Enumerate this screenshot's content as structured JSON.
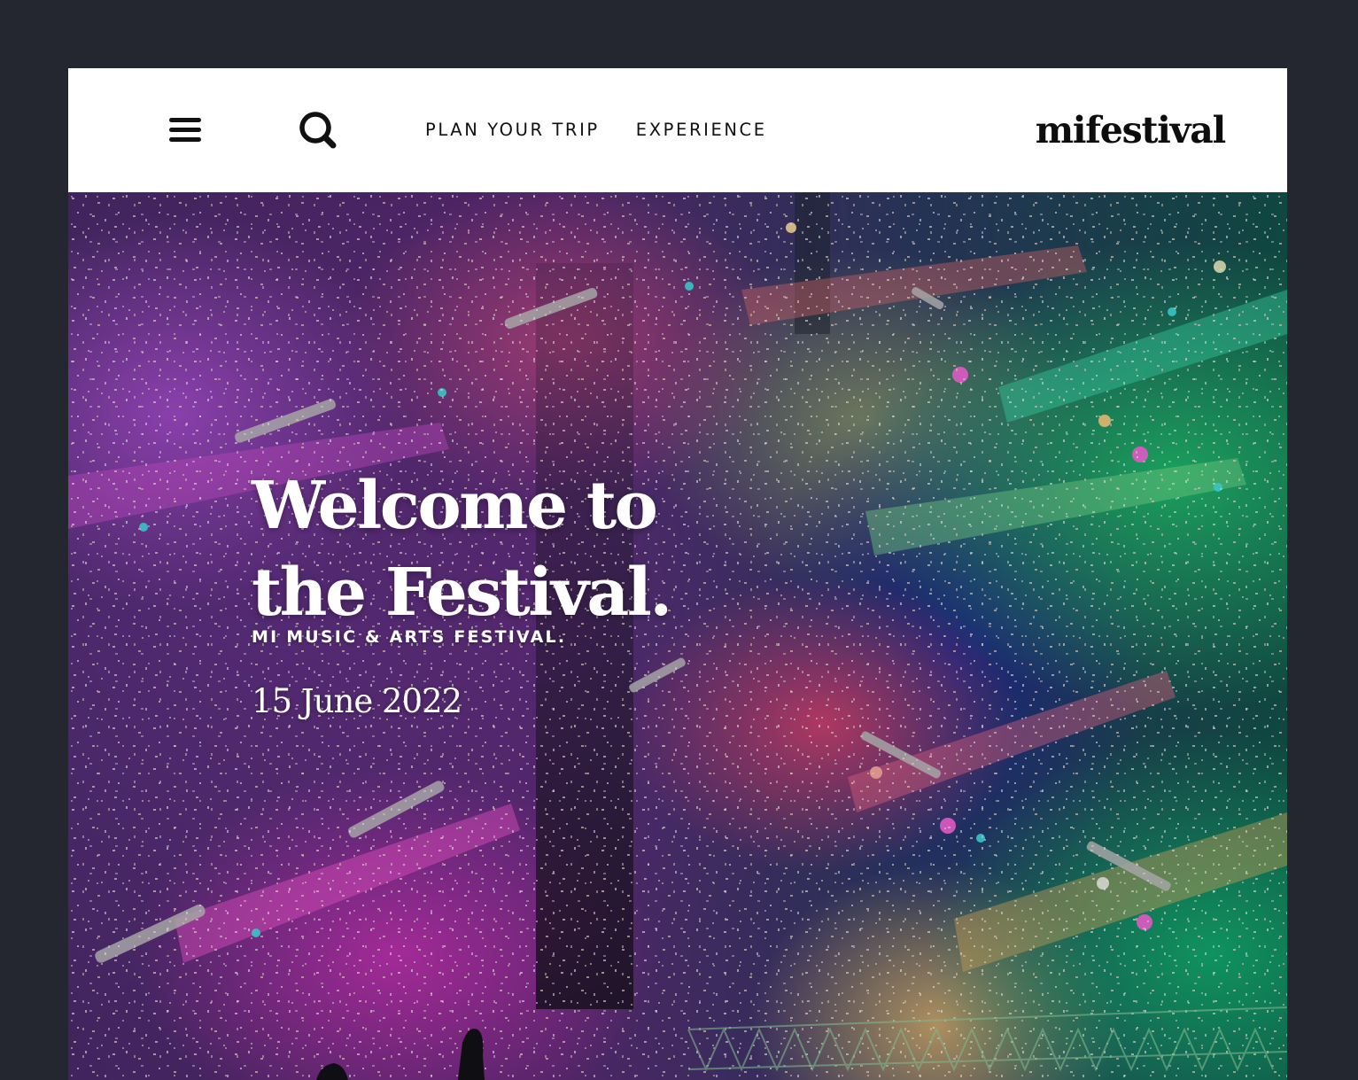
{
  "header": {
    "nav": [
      "PLAN YOUR TRIP",
      "EXPERIENCE"
    ],
    "logo": "mifestival",
    "icons": [
      "menu-icon",
      "search-icon"
    ]
  },
  "hero": {
    "title_line1": "Welcome to",
    "title_line2": "the Festival.",
    "subtitle": "MI MUSIC & ARTS FESTIVAL.",
    "date": "15 June 2022"
  },
  "colors": {
    "page_background": "#242730",
    "header_background": "#ffffff",
    "text_dark": "#111111",
    "hero_text": "#ffffff"
  }
}
